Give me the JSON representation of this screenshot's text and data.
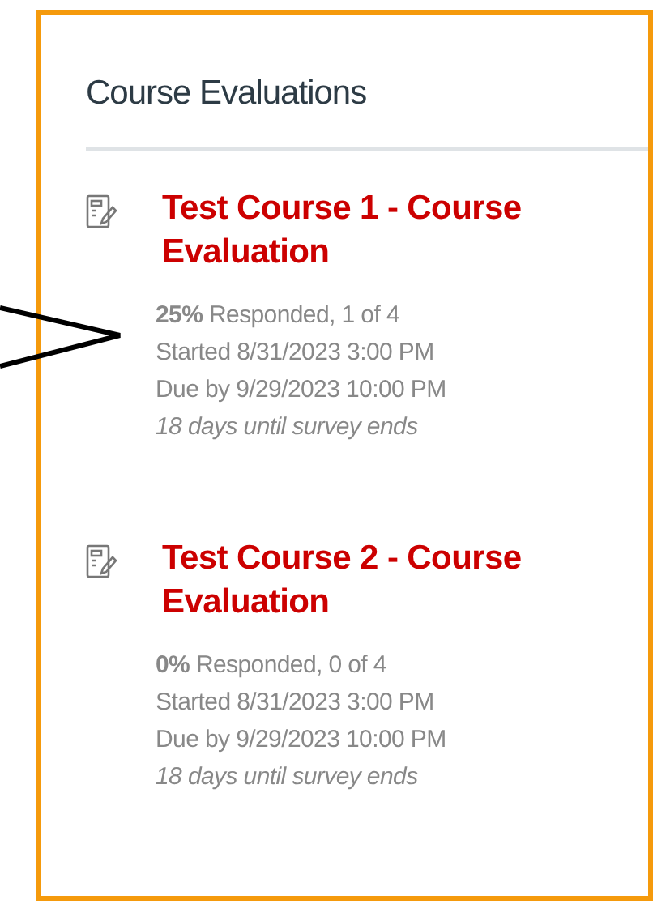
{
  "panel": {
    "title": "Course Evaluations"
  },
  "evaluations": [
    {
      "title": "Test Course 1 - Course Evaluation",
      "response": "**25%** Responded, 1 of 4",
      "started": "Started 8/31/2023 3:00 PM",
      "due": "Due by 9/29/2023 10:00 PM",
      "remaining": "18 days until survey ends"
    },
    {
      "title": "Test Course 2 - Course Evaluation",
      "response": "**0%** Responded, 0 of 4",
      "started": "Started 8/31/2023 3:00 PM",
      "due": "Due by 9/29/2023 10:00 PM",
      "remaining": "18 days until survey ends"
    }
  ]
}
